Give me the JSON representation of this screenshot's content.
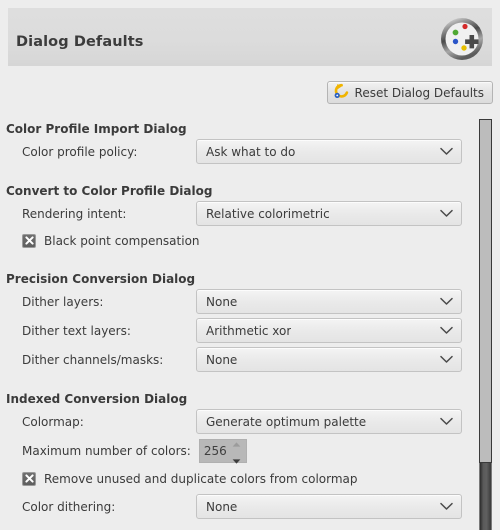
{
  "window": {
    "title": "Dialog Defaults",
    "header_icon": "dialog-defaults-icon"
  },
  "toolbar": {
    "reset_label": "Reset Dialog Defaults",
    "reset_icon": "reset-arrow-icon"
  },
  "colors": {
    "background": "#ededed",
    "titlebar": "#dcdcdc",
    "text": "#3b3b3b",
    "combo_border": "#c3c3c3",
    "checkbox_fill": "#5e5e5e",
    "icon_red": "#d42a2a",
    "icon_green": "#4fa832",
    "icon_blue": "#2a55c8",
    "icon_yellow": "#e8c000",
    "reset_arrow": "#f0b400",
    "reset_dot": "#2a60c0"
  },
  "sections": [
    {
      "heading": "Color Profile Import Dialog",
      "rows": [
        {
          "kind": "combo",
          "label": "Color profile policy:",
          "value": "Ask what to do"
        }
      ]
    },
    {
      "heading": "Convert to Color Profile Dialog",
      "rows": [
        {
          "kind": "combo",
          "label": "Rendering intent:",
          "value": "Relative colorimetric"
        },
        {
          "kind": "check",
          "label": "Black point compensation",
          "checked": true
        }
      ]
    },
    {
      "heading": "Precision Conversion Dialog",
      "rows": [
        {
          "kind": "combo",
          "label": "Dither layers:",
          "value": "None"
        },
        {
          "kind": "combo",
          "label": "Dither text layers:",
          "value": "Arithmetic xor"
        },
        {
          "kind": "combo",
          "label": "Dither channels/masks:",
          "value": "None"
        }
      ]
    },
    {
      "heading": "Indexed Conversion Dialog",
      "rows": [
        {
          "kind": "combo",
          "label": "Colormap:",
          "value": "Generate optimum palette"
        },
        {
          "kind": "spin",
          "label": "Maximum number of colors:",
          "value": "256"
        },
        {
          "kind": "check",
          "label": "Remove unused and duplicate colors from colormap",
          "checked": true
        },
        {
          "kind": "combo",
          "label": "Color dithering:",
          "value": "None"
        }
      ]
    }
  ],
  "scrollbar": {
    "orientation": "vertical",
    "position": "top"
  }
}
